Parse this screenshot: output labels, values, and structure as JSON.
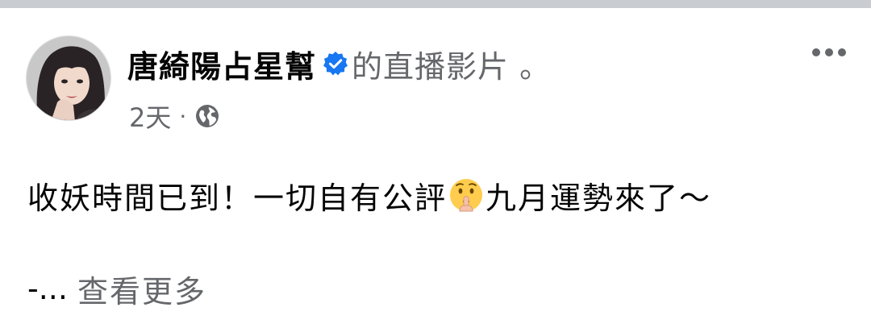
{
  "post": {
    "author_name": "唐綺陽占星幫",
    "action_text": "的直播影片 。",
    "timestamp": "2天",
    "separator": "·",
    "privacy_icon": "globe-icon",
    "verified_icon": "verified-badge-icon",
    "more_icon": "more-options-icon",
    "body": {
      "text_before_emoji": "收妖時間已到！一切自有公評",
      "emoji": "shushing-face-emoji",
      "text_after_emoji": "九月運勢來了～"
    },
    "truncated_prefix": "-...",
    "see_more_label": "查看更多"
  },
  "colors": {
    "primary_text": "#050505",
    "secondary_text": "#65676b",
    "verified_blue": "#1877f2",
    "top_bar": "#c9ccd1"
  }
}
